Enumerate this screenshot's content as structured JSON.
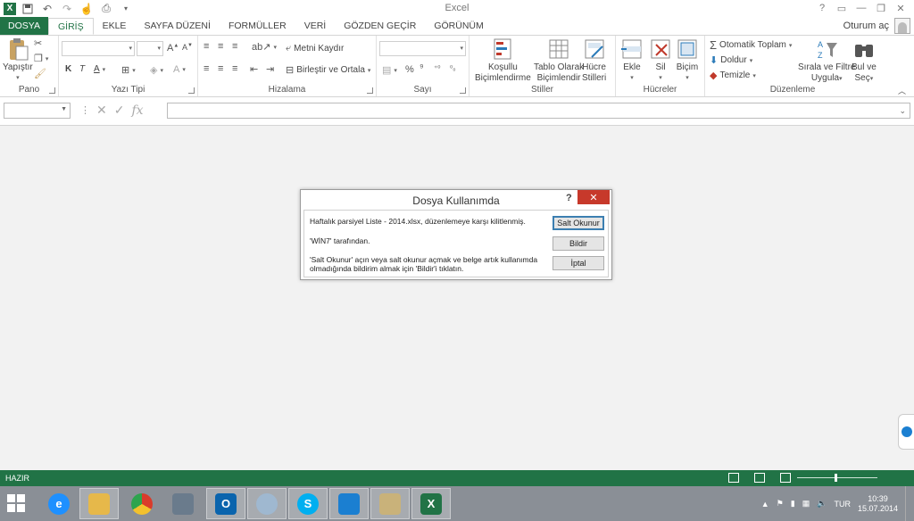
{
  "app": {
    "title": "Excel",
    "logo": "X",
    "qat_icons": [
      "save-icon",
      "undo-icon",
      "redo-icon",
      "touch-mode-icon",
      "print-preview-icon",
      "customize-qat-icon"
    ],
    "window_controls": [
      "?",
      "▭",
      "—",
      "❐",
      "✕"
    ]
  },
  "tabs": [
    {
      "label": "DOSYA",
      "kind": "file"
    },
    {
      "label": "GİRİŞ",
      "kind": "active"
    },
    {
      "label": "EKLE"
    },
    {
      "label": "SAYFA DÜZENİ"
    },
    {
      "label": "FORMÜLLER"
    },
    {
      "label": "VERİ"
    },
    {
      "label": "GÖZDEN GEÇİR"
    },
    {
      "label": "GÖRÜNÜM"
    }
  ],
  "signin": "Oturum aç",
  "ribbon": {
    "groups": {
      "clipboard": "Pano",
      "font": "Yazı Tipi",
      "alignment": "Hizalama",
      "number": "Sayı",
      "styles": "Stiller",
      "cells": "Hücreler",
      "editing": "Düzenleme"
    },
    "paste": "Yapıştır",
    "bold": "K",
    "italic": "T",
    "underline": "A",
    "wrap_text": "Metni Kaydır",
    "merge_center": "Birleştir ve Ortala",
    "percent": "%",
    "comma": "⁹",
    "conditional_formatting": [
      "Koşullu",
      "Biçimlendirme"
    ],
    "format_as_table": [
      "Tablo Olarak",
      "Biçimlendir"
    ],
    "cell_styles": [
      "Hücre",
      "Stilleri"
    ],
    "insert": "Ekle",
    "delete": "Sil",
    "format": "Biçim",
    "autosum": "Otomatik Toplam",
    "fill": "Doldur",
    "clear": "Temizle",
    "sort_filter": [
      "Sırala ve Filtre",
      "Uygula"
    ],
    "find_select": [
      "Bul ve",
      "Seç"
    ]
  },
  "formula_bar": {
    "name_box": "",
    "fx": "fx",
    "value": ""
  },
  "dialog": {
    "title": "Dosya Kullanımda",
    "help": "?",
    "close": "✕",
    "message_1": "Haftalık parsiyel Liste - 2014.xlsx, düzenlemeye karşı kilitlenmiş.",
    "message_2": "'WİN7' tarafından.",
    "message_3a": "'Salt Okunur' açın veya salt okunur açmak ve belge artık kullanımda",
    "message_3b": "olmadığında bildirim almak için 'Bildir'i tıklatın.",
    "btn_readonly": "Salt Okunur",
    "btn_notify": "Bildir",
    "btn_cancel": "İptal"
  },
  "status": {
    "text": "HAZIR"
  },
  "taskbar": {
    "apps": [
      {
        "name": "internet-explorer",
        "glyph": "e",
        "color": "#1e90ff"
      },
      {
        "name": "file-explorer",
        "glyph": "",
        "color": "#e6b84a"
      },
      {
        "name": "chrome",
        "glyph": "",
        "color": "#d93b2b"
      },
      {
        "name": "calculator",
        "glyph": "",
        "color": "#6a7b8c"
      },
      {
        "name": "outlook",
        "glyph": "O",
        "color": "#0a64ad"
      },
      {
        "name": "globe-app",
        "glyph": "",
        "color": "#9fb8d0"
      },
      {
        "name": "skype",
        "glyph": "S",
        "color": "#00aff0"
      },
      {
        "name": "teamviewer",
        "glyph": "",
        "color": "#1b7fd1"
      },
      {
        "name": "paint",
        "glyph": "",
        "color": "#c9b27a"
      },
      {
        "name": "excel",
        "glyph": "X",
        "color": "#217346"
      }
    ],
    "language": "TUR",
    "time": "10:39",
    "date": "15.07.2014"
  }
}
